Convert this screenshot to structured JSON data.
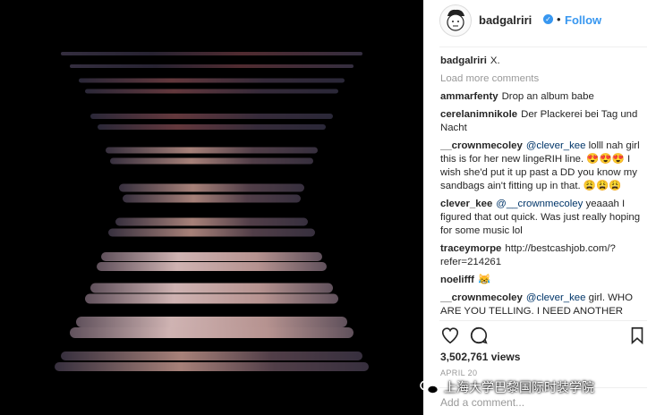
{
  "post": {
    "username": "badgalriri",
    "follow_label": "Follow",
    "separator": "•",
    "verified_glyph": "✓",
    "caption": "X.",
    "load_more": "Load more comments",
    "views": "3,502,761 views",
    "date": "APRIL 20",
    "add_comment_placeholder": "Add a comment..."
  },
  "comments": [
    {
      "user": "ammarfenty",
      "text": "Drop an album babe"
    },
    {
      "user": "cerelanimnikole",
      "text": "Der Plackerei bei Tag und Nacht"
    },
    {
      "user": "__crownmecoley",
      "mention": "@clever_kee",
      "text": " lolll nah girl this is for her new lingeRIH line. 😍😍😍 I wish she'd put it up past a DD you know my sandbags ain't fitting up in that. 😩😩😩"
    },
    {
      "user": "clever_kee",
      "mention": "@__crownmecoley",
      "text": " yeaaah I figured that out quick. Was just really hoping for some music lol"
    },
    {
      "user": "traceymorpe",
      "text": "http://bestcashjob.com/?refer=214261"
    },
    {
      "user": "noelifff",
      "text": "😹"
    },
    {
      "user": "__crownmecoley",
      "mention": "@clever_kee",
      "text": " girl. WHO ARE YOU TELLING. I NEED ANOTHER"
    }
  ],
  "icons": {
    "like": "heart-icon",
    "comment": "comment-icon",
    "save": "bookmark-icon",
    "watermark": "wechat-icon"
  },
  "watermark_text": "上海大学巴黎国际时装学院",
  "colors": {
    "accent": "#3897f0",
    "text": "#262626",
    "muted": "#999999",
    "media_bg": "#000000"
  }
}
